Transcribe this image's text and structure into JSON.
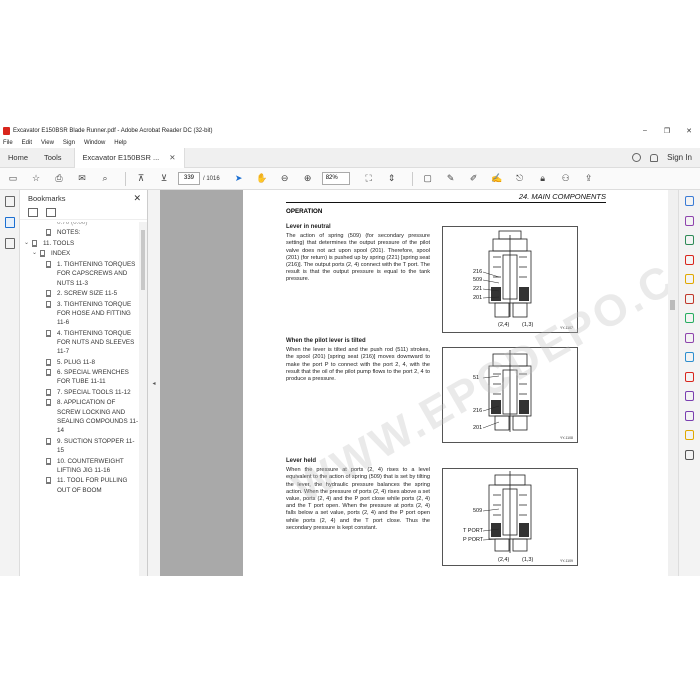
{
  "window": {
    "title": "Excavator E150BSR Blade Runner.pdf - Adobe Acrobat Reader DC (32-bit)",
    "controls": [
      "–",
      "❐",
      "✕"
    ]
  },
  "menu": [
    "File",
    "Edit",
    "View",
    "Sign",
    "Window",
    "Help"
  ],
  "tabs": {
    "home": "Home",
    "tools": "Tools",
    "document": "Excavator E150BSR ...",
    "close": "✕"
  },
  "account": {
    "sign_in": "Sign In"
  },
  "toolbar": {
    "page_current": "339",
    "page_total": "/ 1016",
    "zoom": "82%"
  },
  "bookmarks": {
    "title": "Bookmarks",
    "close": "✕",
    "items": [
      {
        "text": "0.70 (0.00)",
        "level": 3,
        "flag": false
      },
      {
        "text": "NOTES:",
        "level": 3,
        "flag": true
      },
      {
        "text": "11. TOOLS",
        "level": 1,
        "flag": true,
        "arrow": "⌄"
      },
      {
        "text": "INDEX",
        "level": 2,
        "flag": true,
        "arrow": "⌄"
      },
      {
        "text": "1. TIGHTENING TORQUES FOR CAPSCREWS AND NUTS 11-3",
        "level": 3,
        "flag": true
      },
      {
        "text": "2. SCREW SIZE 11-5",
        "level": 3,
        "flag": true
      },
      {
        "text": "3. TIGHTENING TORQUE FOR HOSE AND FITTING 11-6",
        "level": 3,
        "flag": true
      },
      {
        "text": "4. TIGHTENING TORQUE FOR NUTS AND SLEEVES 11-7",
        "level": 3,
        "flag": true
      },
      {
        "text": "5. PLUG 11-8",
        "level": 3,
        "flag": true
      },
      {
        "text": "6. SPECIAL WRENCHES FOR TUBE 11-11",
        "level": 3,
        "flag": true
      },
      {
        "text": "7. SPECIAL TOOLS 11-12",
        "level": 3,
        "flag": true
      },
      {
        "text": "8. APPLICATION OF SCREW LOCKING AND SEALING COMPOUNDS 11-14",
        "level": 3,
        "flag": true
      },
      {
        "text": "9. SUCTION STOPPER 11-15",
        "level": 3,
        "flag": true
      },
      {
        "text": "10. COUNTERWEIGHT LIFTING JIG 11-16",
        "level": 3,
        "flag": true
      },
      {
        "text": "11. TOOL FOR PULLING OUT OF BOOM",
        "level": 3,
        "flag": true
      }
    ]
  },
  "page": {
    "header": "24. MAIN COMPONENTS",
    "operation": "OPERATION",
    "sections": [
      {
        "title": "Lever in neutral",
        "body": "The action of spring (509) (for secondary pressure setting) that determines the output pressure of the pilot valve does not act upon spool (201). Therefore, spool (201) (for return) is pushed up by spring (221) [spring seat (216)]. The output ports (2, 4) connect with the T port. The result is that the output pressure is equal to the tank pressure.",
        "labels": [
          "216",
          "509",
          "221",
          "201"
        ],
        "ports": [
          "(2,4)",
          "(1,3)"
        ],
        "code": "YY-1107"
      },
      {
        "title": "When the pilot lever is tilted",
        "body": "When the lever is tilted and the push rod (511) strokes, the spool (201) [spring seat (216)] moves downward to make the port P to connect with the port 2, 4, with the result that the oil of the pilot pump flows to the port 2, 4 to produce a pressure.",
        "labels": [
          "51",
          "216",
          "201"
        ],
        "ports": [],
        "code": "YY-1108"
      },
      {
        "title": "Lever held",
        "body": "When the pressure at ports (2, 4) rises to a level equivalent to the action of spring (509) that is set by tilting the lever, the hydraulic pressure balances the spring action. When the pressure of ports (2, 4) rises above a set value, ports (2, 4) and the P port close while ports (2, 4) and the T port open. When the pressure at ports (2, 4) falls below a set value, ports (2, 4) and the P port open while ports (2, 4) and the T port close. Thus the secondary pressure is kept constant.",
        "labels": [
          "509",
          "T PORT",
          "P PORT"
        ],
        "ports": [
          "(2,4)",
          "(1,3)"
        ],
        "code": "YY-1109"
      }
    ],
    "watermark": "WWW.EPCDEPO.COM"
  },
  "icons": {
    "left_rail": [
      "page-thumbnails-icon",
      "bookmark-icon",
      "attachment-icon"
    ],
    "right_rail_colors": [
      "#3a7bd5",
      "#8e44ad",
      "#2e8b57",
      "#d9251c",
      "#e0a800",
      "#c0392b",
      "#27ae60",
      "#8e44ad",
      "#2c8fcf",
      "#d9251c",
      "#7a3fb0",
      "#7a3fb0",
      "#e0a800",
      "#555555"
    ]
  }
}
